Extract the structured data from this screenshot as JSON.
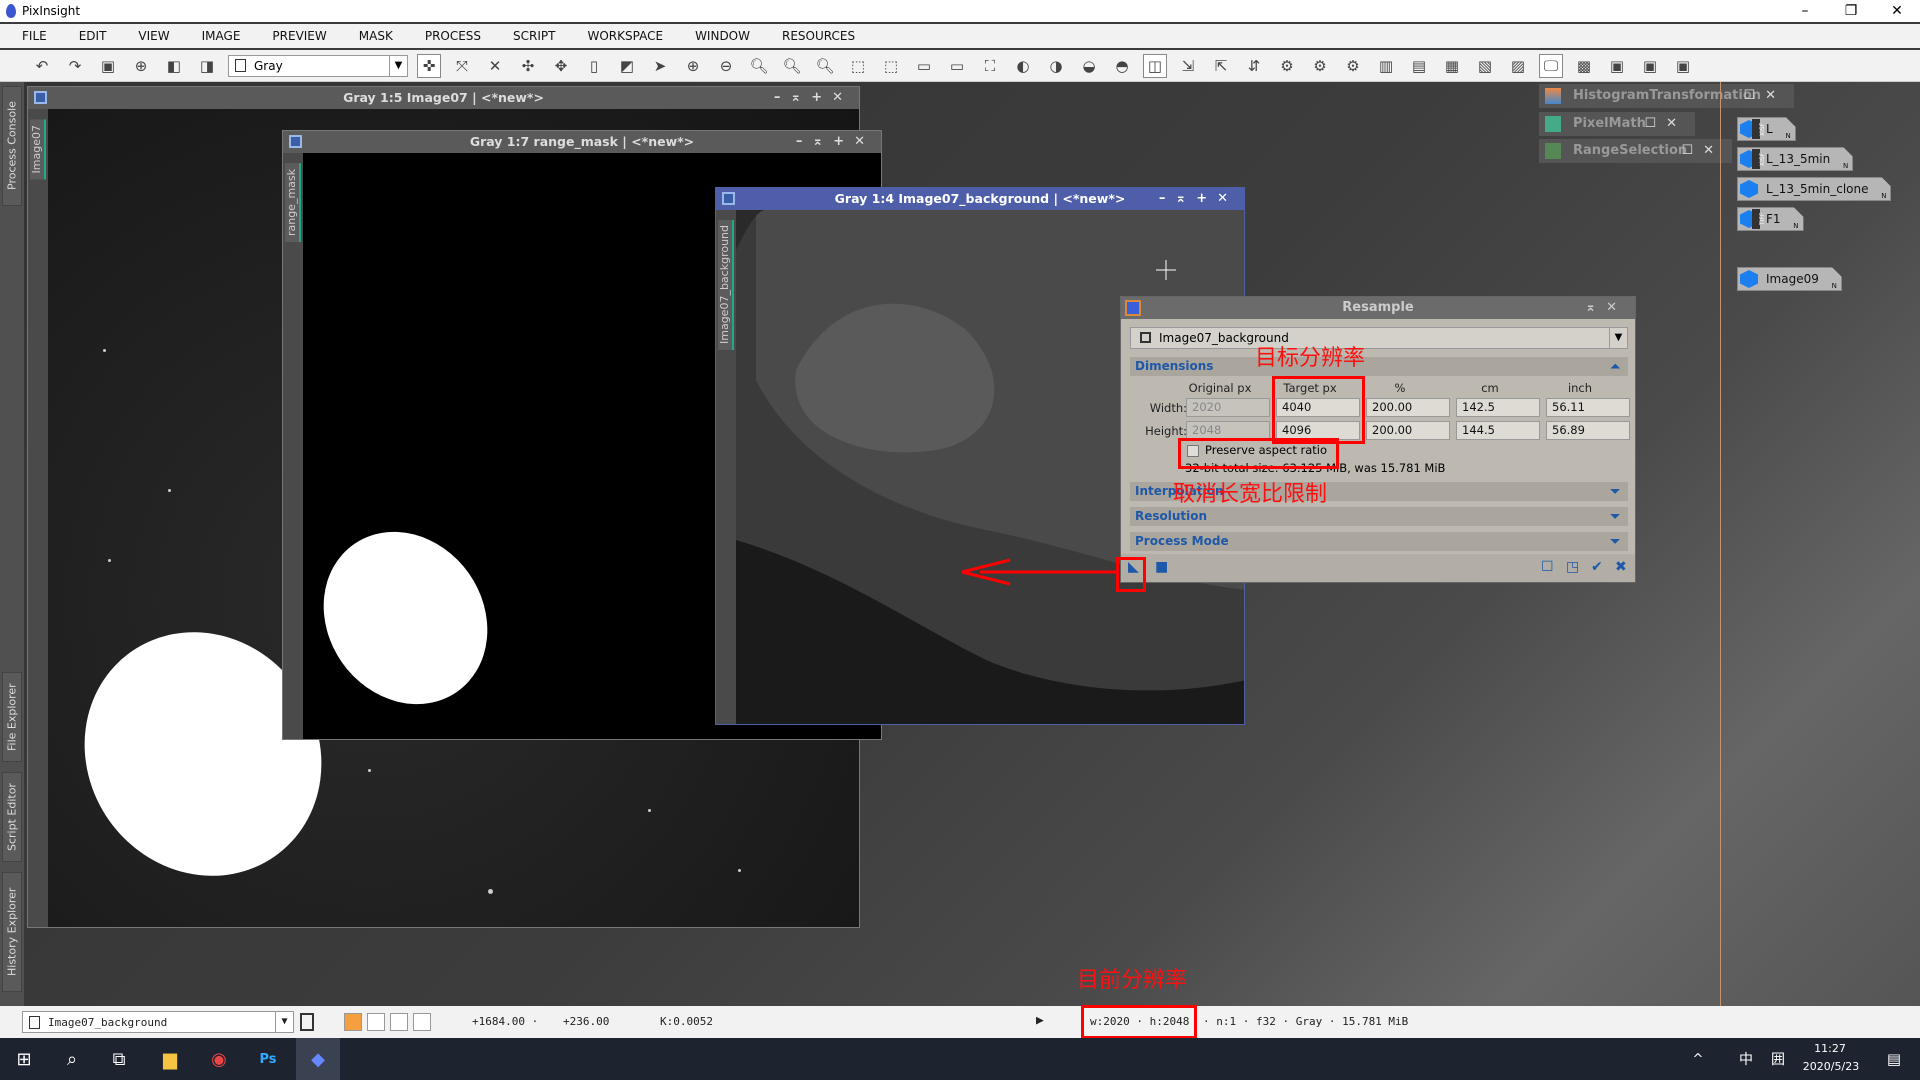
{
  "app": {
    "title": "PixInsight"
  },
  "menu": [
    "FILE",
    "EDIT",
    "VIEW",
    "IMAGE",
    "PREVIEW",
    "MASK",
    "PROCESS",
    "SCRIPT",
    "WORKSPACE",
    "WINDOW",
    "RESOURCES"
  ],
  "toolbar": {
    "color_space": "Gray"
  },
  "left_tabs": [
    "Process Console",
    "File Explorer",
    "Script Editor",
    "History Explorer"
  ],
  "windows": {
    "image07": {
      "title": "Gray 1:5 Image07 | <*new*>",
      "side_label": "Image07"
    },
    "range_mask": {
      "title": "Gray 1:7 range_mask | <*new*>",
      "side_label": "range_mask"
    },
    "background": {
      "title": "Gray 1:4 Image07_background | <*new*>",
      "side_label": "Image07_background"
    }
  },
  "resample": {
    "title": "Resample",
    "target_view": "Image07_background",
    "sections": {
      "dimensions": "Dimensions",
      "interpolation": "Interpolation",
      "resolution": "Resolution",
      "process_mode": "Process Mode"
    },
    "columns": [
      "Original px",
      "Target px",
      "%",
      "cm",
      "inch"
    ],
    "width_label": "Width:",
    "height_label": "Height:",
    "width": {
      "original": "2020",
      "target": "4040",
      "percent": "200.00",
      "cm": "142.5",
      "inch": "56.11"
    },
    "height": {
      "original": "2048",
      "target": "4096",
      "percent": "200.00",
      "cm": "144.5",
      "inch": "56.89"
    },
    "preserve_aspect_label": "Preserve aspect ratio",
    "preserve_aspect_checked": false,
    "size_info": "32-bit total size: 63.125 MiB, was 15.781 MiB"
  },
  "annotations": {
    "target_resolution": "目标分辨率",
    "cancel_aspect": "取消长宽比限制",
    "current_resolution": "目前分辨率",
    "color": "#ff0000"
  },
  "process_icons": [
    "HistogramTransformation",
    "PixelMath",
    "RangeSelection"
  ],
  "image_icons": [
    {
      "label": "L",
      "format": "XISF"
    },
    {
      "label": "L_13_5min",
      "format": "XISF"
    },
    {
      "label": "L_13_5min_clone",
      "format": ""
    },
    {
      "label": "F1",
      "format": "TIFF"
    },
    {
      "label": "Image09",
      "format": ""
    }
  ],
  "status": {
    "view": "Image07_background",
    "x": "+1684.00 ·",
    "y": "+236.00",
    "k": "K:0.0052",
    "info_wh": "w:2020 · h:2048",
    "info_rest": "· n:1 · f32 · Gray · 15.781 MiB"
  },
  "taskbar": {
    "time": "11:27",
    "date": "2020/5/23",
    "ime": "中"
  }
}
